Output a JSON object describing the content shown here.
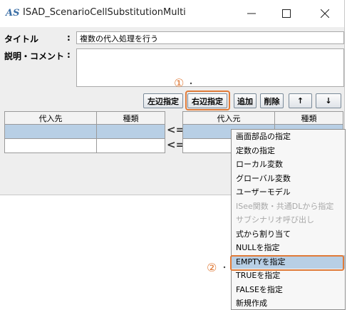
{
  "window": {
    "title": "ISAD_ScenarioCellSubstitutionMulti",
    "icon_text": "AS"
  },
  "form": {
    "title_label": "タイトル",
    "title_value": "複数の代入処理を行う",
    "comment_label": "説明・コメント",
    "colon": ":"
  },
  "toolbar": {
    "left_assign": "左辺指定",
    "right_assign": "右辺指定",
    "add": "追加",
    "delete": "削除",
    "up": "↑",
    "down": "↓"
  },
  "left_table": {
    "headers": [
      "代入先",
      "種類"
    ]
  },
  "right_table": {
    "headers": [
      "代入元",
      "種類"
    ]
  },
  "arrows": [
    "<=",
    "<="
  ],
  "annotations": {
    "step1": "①",
    "step2": "②"
  },
  "context_menu": {
    "items": [
      {
        "label": "画面部品の指定",
        "enabled": true
      },
      {
        "label": "定数の指定",
        "enabled": true
      },
      {
        "label": "ローカル変数",
        "enabled": true
      },
      {
        "label": "グローバル変数",
        "enabled": true
      },
      {
        "label": "ユーザーモデル",
        "enabled": true
      },
      {
        "label": "ISee関数・共通DLから指定",
        "enabled": false
      },
      {
        "label": "サブシナリオ呼び出し",
        "enabled": false
      },
      {
        "label": "式から割り当て",
        "enabled": true
      },
      {
        "label": "NULLを指定",
        "enabled": true
      },
      {
        "label": "EMPTYを指定",
        "enabled": true,
        "selected": true
      },
      {
        "label": "TRUEを指定",
        "enabled": true
      },
      {
        "label": "FALSEを指定",
        "enabled": true
      },
      {
        "label": "新規作成",
        "enabled": true
      }
    ]
  },
  "colors": {
    "highlight": "#e07b39",
    "selection": "#b8cfe5"
  }
}
